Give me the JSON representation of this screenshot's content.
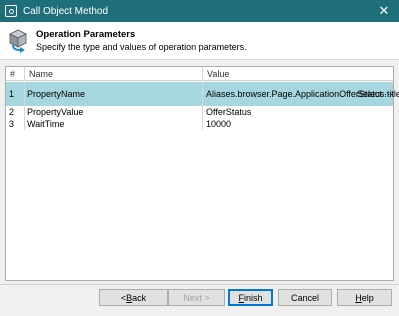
{
  "window": {
    "title": "Call Object Method",
    "close_glyph": "✕"
  },
  "header": {
    "title": "Operation Parameters",
    "subtitle": "Specify the type and values of operation parameters.",
    "icon": "cube-arrow-icon"
  },
  "grid": {
    "columns": [
      "#",
      "Name",
      "Value"
    ],
    "rows": [
      {
        "num": "1",
        "name": "PropertyName",
        "value": "Aliases.browser.Page.ApplicationOfferStatus.title",
        "selected": true,
        "action_label": "Select",
        "more_label": "···"
      },
      {
        "num": "2",
        "name": "PropertyValue",
        "value": "OfferStatus",
        "selected": false
      },
      {
        "num": "3",
        "name": "WaitTime",
        "value": "10000",
        "selected": false
      }
    ]
  },
  "buttons": {
    "back": {
      "prefix": "< ",
      "mnemonic": "B",
      "rest": "ack"
    },
    "next": {
      "label": "Next >"
    },
    "finish": {
      "mnemonic": "F",
      "rest": "inish"
    },
    "cancel": {
      "label": "Cancel"
    },
    "help": {
      "mnemonic": "H",
      "rest": "elp"
    }
  },
  "colors": {
    "titlebar": "#1f6f7a",
    "selection": "#a6d6df",
    "focus": "#0078d7"
  }
}
